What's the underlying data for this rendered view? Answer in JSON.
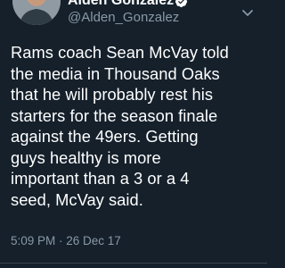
{
  "tweet": {
    "author": {
      "display_name": "Alden Gonzalez",
      "handle": "@Alden_Gonzalez",
      "verified": true
    },
    "text": "Rams coach Sean McVay told\nthe media in Thousand Oaks\nthat he will probably rest his\nstarters for the season finale\nagainst the 49ers. Getting\nguys healthy is more\nimportant than a 3 or a 4\nseed, McVay said.",
    "timestamp": "5:09 PM · 26 Dec 17"
  },
  "colors": {
    "background": "#15202b",
    "text_primary": "#ffffff",
    "text_secondary": "#8899a6",
    "divider": "#38444d"
  },
  "icons": [
    "verified-icon",
    "chevron-down-icon"
  ]
}
